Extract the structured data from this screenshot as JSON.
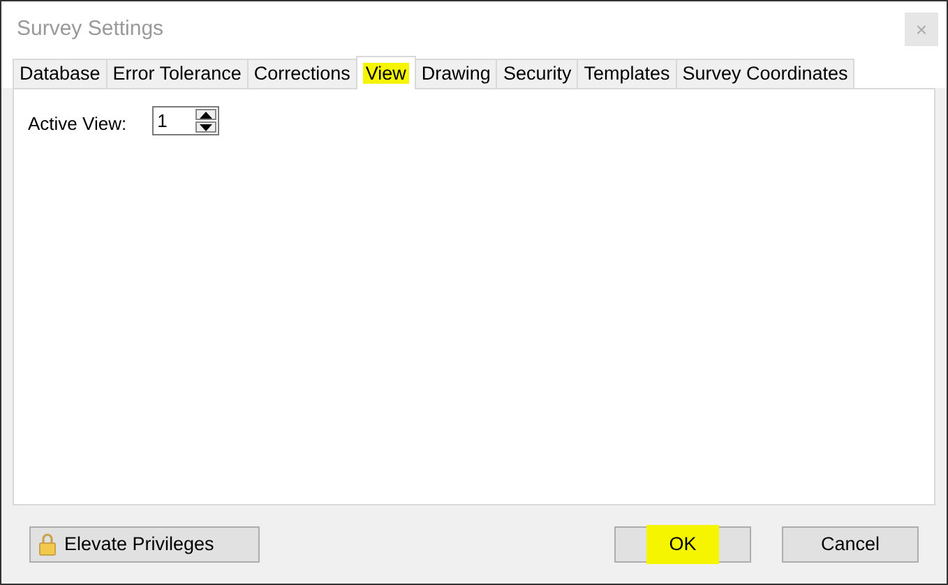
{
  "window": {
    "title": "Survey Settings",
    "close": "×"
  },
  "tabs": [
    {
      "label": "Database",
      "selected": false,
      "highlighted": false
    },
    {
      "label": "Error Tolerance",
      "selected": false,
      "highlighted": false
    },
    {
      "label": "Corrections",
      "selected": false,
      "highlighted": false
    },
    {
      "label": "View",
      "selected": true,
      "highlighted": true
    },
    {
      "label": "Drawing",
      "selected": false,
      "highlighted": false
    },
    {
      "label": "Security",
      "selected": false,
      "highlighted": false
    },
    {
      "label": "Templates",
      "selected": false,
      "highlighted": false
    },
    {
      "label": "Survey Coordinates",
      "selected": false,
      "highlighted": false
    }
  ],
  "active_view": {
    "label": "Active View:",
    "value": "1"
  },
  "buttons": [
    {
      "kind": "elevate",
      "label": "Elevate Privileges",
      "highlighted": false
    },
    {
      "kind": "ok",
      "label": "OK",
      "highlighted": true
    },
    {
      "kind": "cancel",
      "label": "Cancel",
      "highlighted": false
    }
  ]
}
